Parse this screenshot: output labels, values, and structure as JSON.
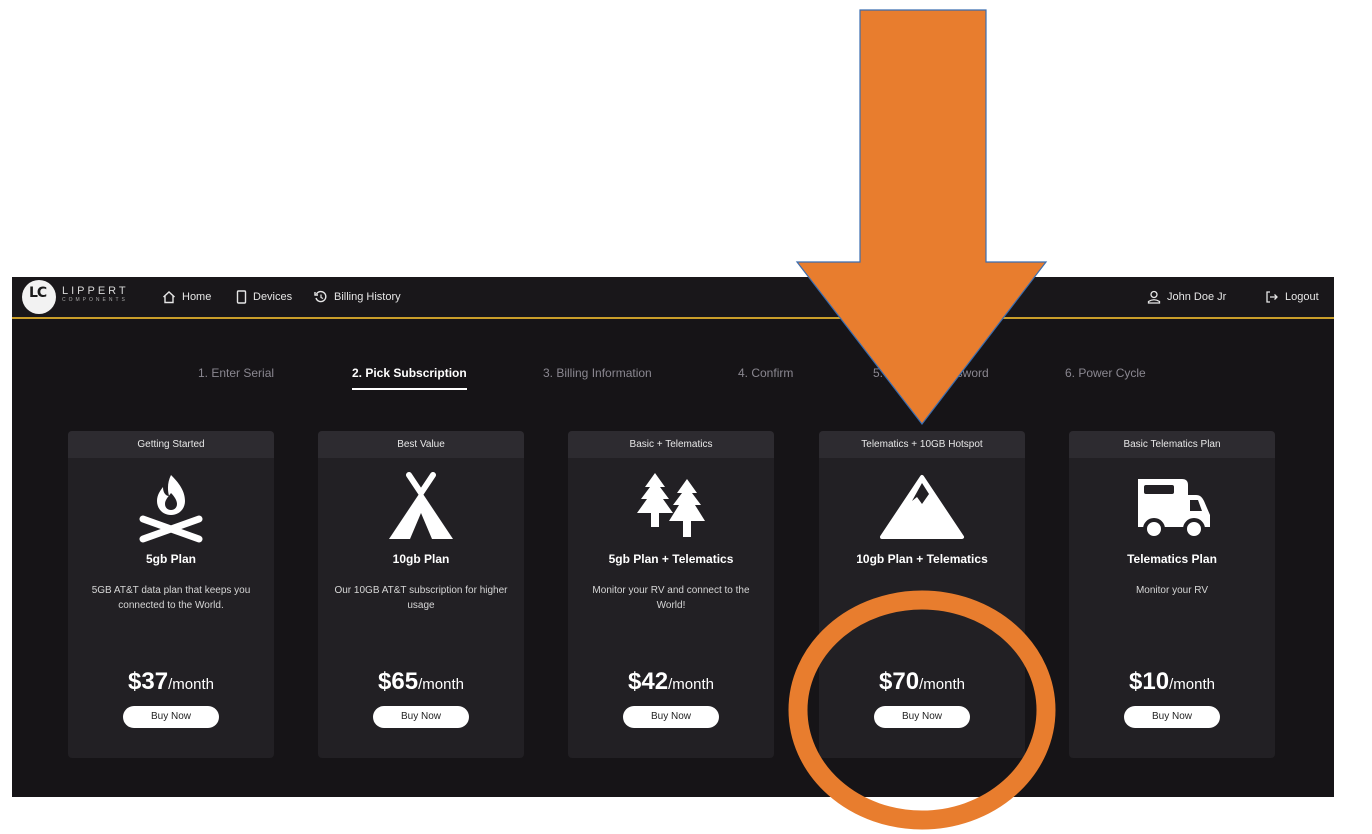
{
  "brand": {
    "name": "LIPPERT",
    "sub": "COMPONENTS",
    "mark": "LC"
  },
  "nav": {
    "home": "Home",
    "devices": "Devices",
    "billing_history": "Billing History"
  },
  "user": {
    "name": "John Doe Jr",
    "logout": "Logout"
  },
  "steps": [
    "1. Enter Serial",
    "2. Pick Subscription",
    "3. Billing Information",
    "4. Confirm",
    "5. Cha",
    "assword",
    "6. Power Cycle"
  ],
  "plans": [
    {
      "header": "Getting Started",
      "icon": "campfire-icon",
      "name": "5gb Plan",
      "desc": "5GB AT&T data plan that keeps you connected to the World.",
      "price": "$37",
      "unit": "/month",
      "button": "Buy Now"
    },
    {
      "header": "Best Value",
      "icon": "tent-icon",
      "name": "10gb Plan",
      "desc": "Our 10GB AT&T subscription for higher usage",
      "price": "$65",
      "unit": "/month",
      "button": "Buy Now"
    },
    {
      "header": "Basic + Telematics",
      "icon": "trees-icon",
      "name": "5gb Plan + Telematics",
      "desc": "Monitor your RV and connect to the World!",
      "price": "$42",
      "unit": "/month",
      "button": "Buy Now"
    },
    {
      "header": "Telematics + 10GB Hotspot",
      "icon": "mountain-icon",
      "name": "10gb Plan + Telematics",
      "desc": "",
      "price": "$70",
      "unit": "/month",
      "button": "Buy Now"
    },
    {
      "header": "Basic Telematics Plan",
      "icon": "rv-icon",
      "name": "Telematics Plan",
      "desc": "Monitor your RV",
      "price": "$10",
      "unit": "/month",
      "button": "Buy Now"
    }
  ],
  "annotation": {
    "arrow_color": "#e87d2e",
    "circle_color": "#e87d2e"
  }
}
